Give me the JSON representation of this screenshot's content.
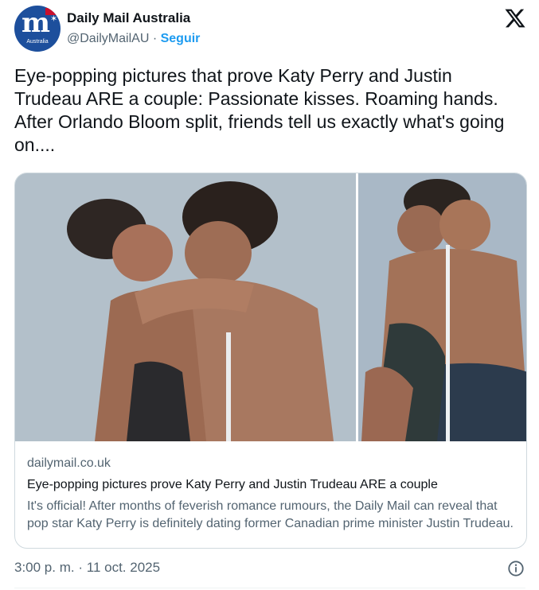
{
  "author": {
    "name": "Daily Mail Australia",
    "handle": "@DailyMailAU",
    "separator": "·",
    "follow_label": "Seguir",
    "avatar_text": "m",
    "avatar_subtext": "Australia"
  },
  "icons": {
    "platform": "x-logo-icon",
    "info": "info-icon"
  },
  "tweet": {
    "text": "Eye-popping pictures that prove Katy Perry and Justin Trudeau ARE a couple: Passionate kisses. Roaming hands. After Orlando Bloom split, friends tell us exactly what's going on...."
  },
  "card": {
    "domain": "dailymail.co.uk",
    "title": "Eye-popping pictures prove Katy Perry and Justin Trudeau ARE a couple",
    "description": "It's official! After months of feverish romance rumours, the Daily Mail can reveal that pop star Katy Perry is definitely dating former Canadian prime minister Justin Trudeau."
  },
  "meta": {
    "time": "3:00 p. m.",
    "separator": "·",
    "date": "11 oct. 2025"
  },
  "colors": {
    "accent": "#1d9bf0",
    "text_primary": "#0f1419",
    "text_secondary": "#536471",
    "border": "#cfd9de",
    "brand": "#1d4f9c"
  }
}
